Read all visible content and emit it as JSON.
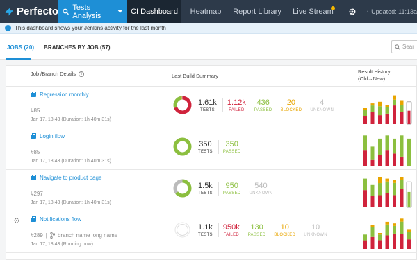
{
  "brand": {
    "name": "Perfecto"
  },
  "nav": {
    "tests_analysis": "Tests Analysis",
    "ci_dashboard": "CI Dashboard",
    "heatmap": "Heatmap",
    "report_library": "Report Library",
    "live_stream": "Live Stream",
    "updated": "Updated: 11:13a"
  },
  "info": {
    "message": "This dashboard shows your Jenkins activity for the last month"
  },
  "tabs": {
    "jobs": "JOBS (20)",
    "branches": "BRANCHES BY JOB (57)"
  },
  "search": {
    "placeholder": "Sear"
  },
  "header": {
    "job": "Job /Branch Details",
    "last_build": "Last Build Summary",
    "result_history": "Result History",
    "history_order": "(Old→New)"
  },
  "colors": {
    "accent": "#1e8fd6",
    "failed": "#d0233c",
    "passed": "#8cbf3f",
    "blocked": "#e8a500",
    "unknown": "#bbbbbb",
    "topbar": "#2d3a4a"
  },
  "jobs": [
    {
      "name": "Regression monthly",
      "number": "#85",
      "branch": "",
      "date": "Jan 17, 18:43",
      "duration": "(Duration: 1h 40m 31s)",
      "stats": [
        {
          "key": "total",
          "value": "1.61k",
          "label": "TESTS"
        },
        {
          "key": "failed",
          "value": "1.12k",
          "label": "FAILED"
        },
        {
          "key": "passed",
          "value": "436",
          "label": "PASSED"
        },
        {
          "key": "blocked",
          "value": "20",
          "label": "BLOCKED"
        },
        {
          "key": "unknown",
          "value": "4",
          "label": "UNKNOWN"
        }
      ],
      "ring": {
        "failed": 0.69,
        "passed": 0.27,
        "blocked": 0.02,
        "unknown": 0.02
      }
    },
    {
      "name": "Login flow",
      "number": "#85",
      "branch": "",
      "date": "Jan 17, 18:43",
      "duration": "(Duration: 1h 40m 31s)",
      "stats": [
        {
          "key": "total",
          "value": "350",
          "label": "TESTS"
        },
        {
          "key": "passed",
          "value": "350",
          "label": "PASSED"
        }
      ],
      "ring": {
        "failed": 0,
        "passed": 1,
        "blocked": 0,
        "unknown": 0
      }
    },
    {
      "name": "Navigate to product page",
      "number": "#297",
      "branch": "",
      "date": "Jan 17, 18:43",
      "duration": "(Duration: 1h 40m 31s)",
      "stats": [
        {
          "key": "total",
          "value": "1.5k",
          "label": "TESTS"
        },
        {
          "key": "passed",
          "value": "950",
          "label": "PASSED"
        },
        {
          "key": "unknown",
          "value": "540",
          "label": "UNKNOWN"
        }
      ],
      "ring": {
        "failed": 0,
        "passed": 0.64,
        "blocked": 0,
        "unknown": 0.36
      }
    },
    {
      "name": "Notifications flow",
      "number": "#289",
      "branch": "branch name long name",
      "date": "Jan 17, 18:43",
      "duration": "(Running now)",
      "stats": [
        {
          "key": "total",
          "value": "1.1k",
          "label": "TESTS"
        },
        {
          "key": "failed",
          "value": "950k",
          "label": "FAILED"
        },
        {
          "key": "passed",
          "value": "130",
          "label": "PASSED"
        },
        {
          "key": "blocked",
          "value": "10",
          "label": "BLOCKED"
        },
        {
          "key": "unknown",
          "value": "10",
          "label": "UNKNOWN"
        }
      ],
      "ring": {
        "failed": 0,
        "passed": 0,
        "blocked": 0,
        "unknown": 1
      },
      "running": true
    }
  ],
  "history": [
    [
      [
        0.5,
        0.4,
        0.1,
        0
      ],
      [
        0.6,
        0.3,
        0.1,
        0
      ],
      [
        0.4,
        0.4,
        0.2,
        0
      ],
      [
        0.55,
        0.35,
        0.1,
        0
      ],
      [
        0.65,
        0.2,
        0.15,
        0
      ],
      [
        0.5,
        0.3,
        0.2,
        0
      ],
      [
        0,
        0,
        0,
        1
      ]
    ],
    [
      [
        0.5,
        0.5,
        0,
        0
      ],
      [
        0.3,
        0.7,
        0,
        0
      ],
      [
        0.4,
        0.6,
        0,
        0
      ],
      [
        0.5,
        0.5,
        0,
        0
      ],
      [
        0.45,
        0.55,
        0,
        0
      ],
      [
        0.3,
        0.7,
        0,
        0
      ],
      [
        0,
        1,
        0,
        0
      ]
    ],
    [
      [
        0.6,
        0.4,
        0,
        0
      ],
      [
        0.5,
        0.5,
        0,
        0
      ],
      [
        0.4,
        0.4,
        0.2,
        0
      ],
      [
        0.5,
        0.4,
        0.1,
        0
      ],
      [
        0.45,
        0.45,
        0.1,
        0
      ],
      [
        0.6,
        0.3,
        0.1,
        0
      ],
      [
        0,
        0,
        0,
        1
      ]
    ],
    [
      [
        0.6,
        0.4,
        0,
        0
      ],
      [
        0.5,
        0.4,
        0.1,
        0
      ],
      [
        0.55,
        0.35,
        0.1,
        0
      ],
      [
        0.5,
        0.4,
        0.1,
        0
      ],
      [
        0.6,
        0.3,
        0.1,
        0
      ],
      [
        0.5,
        0.4,
        0.1,
        0
      ],
      [
        0.5,
        0.4,
        0.1,
        0
      ]
    ]
  ],
  "history_heights": [
    [
      0.5,
      0.65,
      0.7,
      0.6,
      0.9,
      0.75,
      0.7
    ],
    [
      0.95,
      0.6,
      0.85,
      0.95,
      0.85,
      0.95,
      0.85
    ],
    [
      0.9,
      0.7,
      0.95,
      0.9,
      0.85,
      0.95,
      0.8
    ],
    [
      0.45,
      0.75,
      0.5,
      0.85,
      0.8,
      0.95,
      0.6
    ]
  ]
}
